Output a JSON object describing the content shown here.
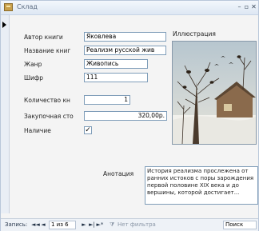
{
  "window": {
    "title": "Склад"
  },
  "fields": [
    {
      "label": "Автор книги",
      "value": "Яковлева"
    },
    {
      "label": "Название книг",
      "value": "Реализм русской жив"
    },
    {
      "label": "Жанр",
      "value": "Живопись"
    },
    {
      "label": "Шифр",
      "value": "111"
    },
    {
      "label": "Количество кн",
      "value": "1"
    },
    {
      "label": "Закупочная сто",
      "value": "320,00р."
    },
    {
      "label": "Наличие",
      "value": "✓"
    }
  ],
  "illustration": {
    "label": "Иллюстрация"
  },
  "annotation": {
    "label": "Анотация",
    "text": "История реализма прослежена от ранних истоков с поры зарождения первой половине XIX века и до вершины, которой достигает..."
  },
  "navigator": {
    "records_label": "Запись:",
    "first": "◄◄",
    "prev": "◄",
    "position": "1 из 6",
    "next": "►",
    "last": "►|",
    "new": "►*",
    "filter_label": "Нет фильтра",
    "search_label": "Поиск"
  }
}
